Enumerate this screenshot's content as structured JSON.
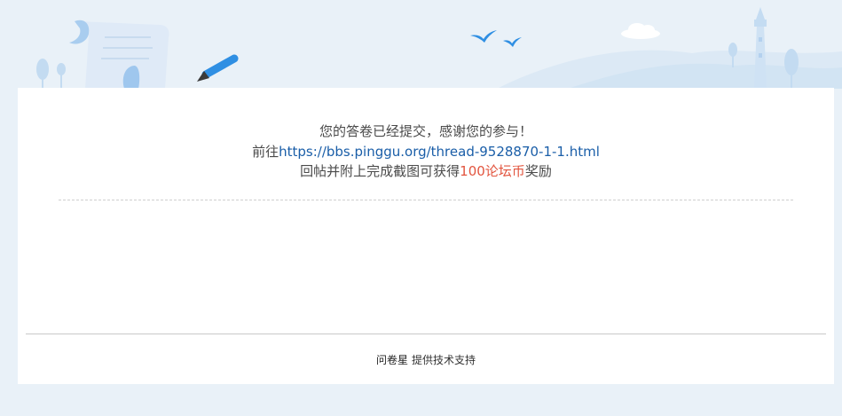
{
  "message": {
    "line1": "您的答卷已经提交，感谢您的参与！",
    "line2_prefix": "前往",
    "line2_link": "https://bbs.pinggu.org/thread-9528870-1-1.html",
    "line3_prefix": "回帖并附上完成截图可获得",
    "line3_reward": "100论坛币",
    "line3_suffix": "奖励"
  },
  "footer": {
    "brand": "问卷星",
    "support_text": "提供技术支持"
  },
  "colors": {
    "page_background": "#e9f1f8",
    "link": "#1a5ea8",
    "reward": "#e2553f",
    "text": "#4a4a4a"
  }
}
